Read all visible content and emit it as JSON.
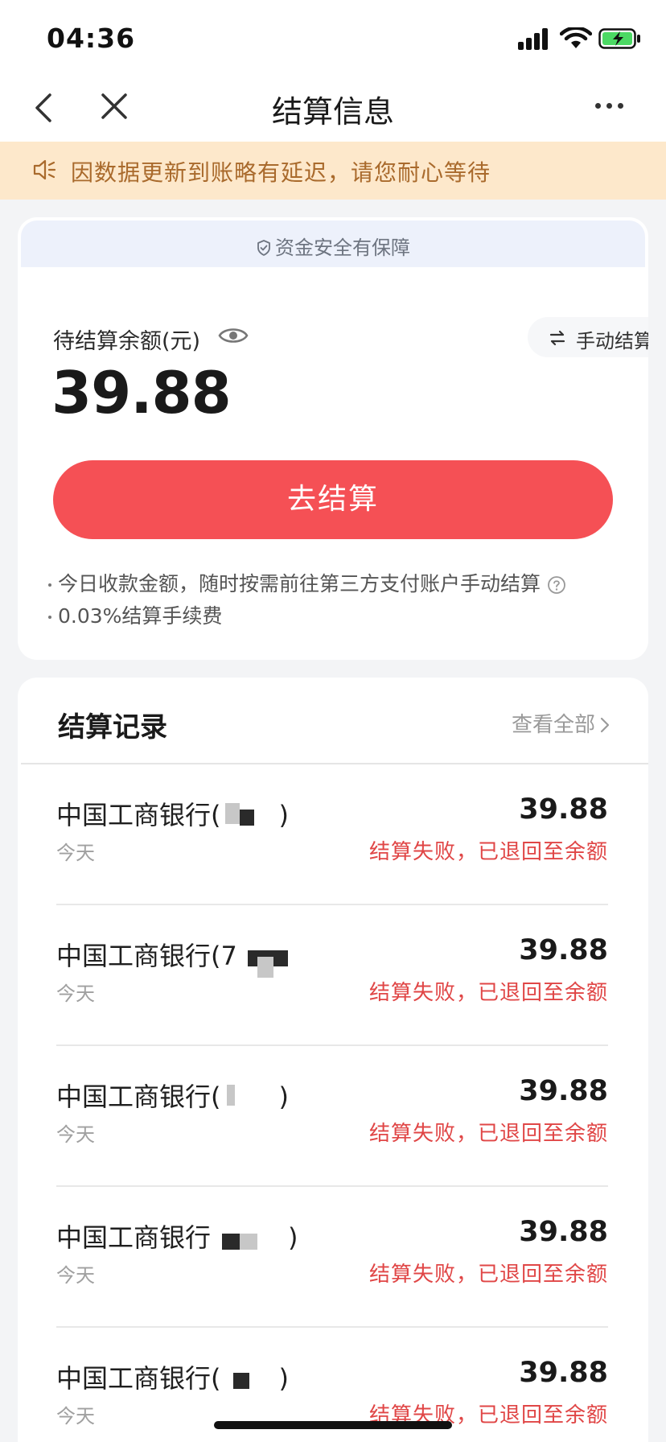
{
  "status_bar": {
    "time": "04:36"
  },
  "nav": {
    "title": "结算信息"
  },
  "notice": {
    "text": "因数据更新到账略有延迟，请您耐心等待"
  },
  "balance": {
    "safety_text": "资金安全有保障",
    "label": "待结算余额(元)",
    "amount": "39.88",
    "manual_label": "手动结算",
    "settle_label": "去结算",
    "notes": [
      "今日收款金额，随时按需前往第三方支付账户手动结算",
      "0.03%结算手续费"
    ]
  },
  "records": {
    "title": "结算记录",
    "view_all": "查看全部",
    "items": [
      {
        "bank": "中国工商银行(",
        "bank_tail": ")",
        "date": "今天",
        "amount": "39.88",
        "status": "结算失败，已退回至余额"
      },
      {
        "bank": "中国工商银行(7",
        "bank_tail": "",
        "date": "今天",
        "amount": "39.88",
        "status": "结算失败，已退回至余额"
      },
      {
        "bank": "中国工商银行(",
        "bank_tail": ")",
        "date": "今天",
        "amount": "39.88",
        "status": "结算失败，已退回至余额"
      },
      {
        "bank": "中国工商银行",
        "bank_tail": ")",
        "date": "今天",
        "amount": "39.88",
        "status": "结算失败，已退回至余额"
      },
      {
        "bank": "中国工商银行(",
        "bank_tail": ")",
        "date": "今天",
        "amount": "39.88",
        "status": "结算失败，已退回至余额"
      }
    ]
  },
  "colors": {
    "accent": "#f55055",
    "error": "#e04646",
    "notice_bg": "#fde8cb",
    "notice_text": "#a96a2c"
  }
}
